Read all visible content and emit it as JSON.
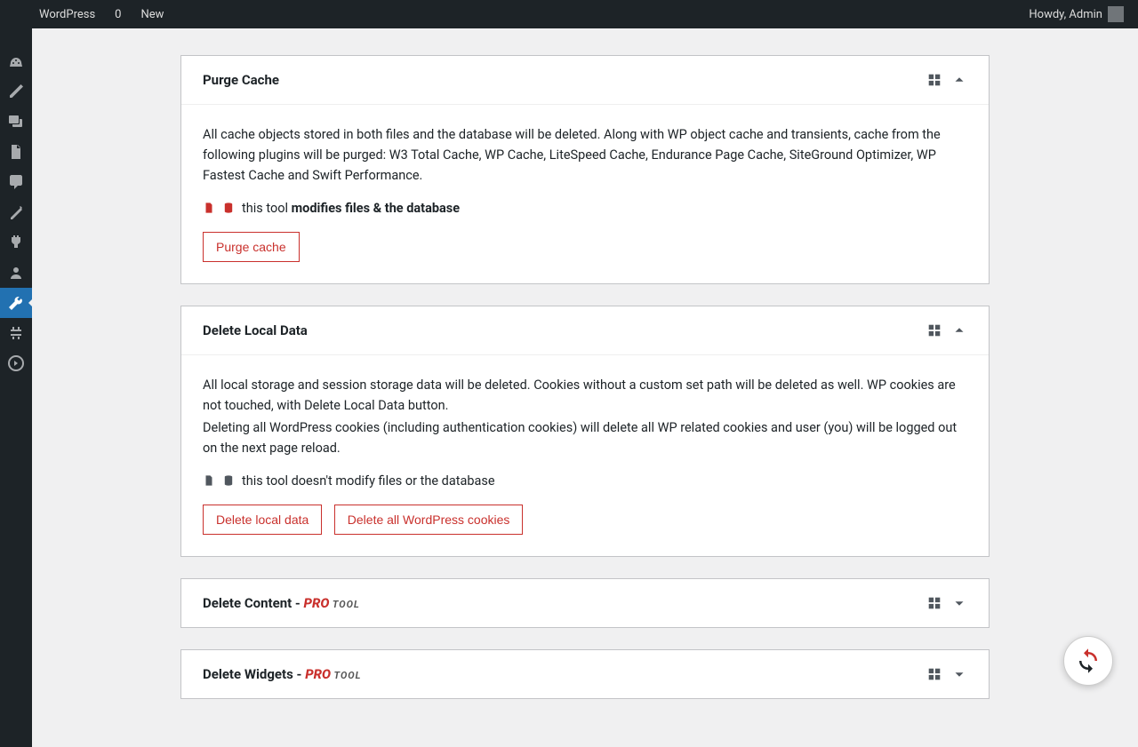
{
  "adminbar": {
    "site_name": "WordPress",
    "comments_count": "0",
    "new_label": "New",
    "howdy": "Howdy, Admin"
  },
  "cards": {
    "purge": {
      "title": "Purge Cache",
      "desc": "All cache objects stored in both files and the database will be deleted. Along with WP object cache and transients, cache from the following plugins will be purged: W3 Total Cache, WP Cache, LiteSpeed Cache, Endurance Page Cache, SiteGround Optimizer, WP Fastest Cache and Swift Performance.",
      "mods_prefix": "this tool ",
      "mods_bold": "modifies files & the database",
      "btn": "Purge cache"
    },
    "local": {
      "title": "Delete Local Data",
      "desc1": "All local storage and session storage data will be deleted. Cookies without a custom set path will be deleted as well. WP cookies are not touched, with Delete Local Data button.",
      "desc2": "Deleting all WordPress cookies (including authentication cookies) will delete all WP related cookies and user (you) will be logged out on the next page reload.",
      "mods": "this tool doesn't modify files or the database",
      "btn1": "Delete local data",
      "btn2": "Delete all WordPress cookies"
    },
    "content": {
      "title_prefix": "Delete Content - ",
      "pro": "PRO",
      "tool": " TOOL"
    },
    "widgets": {
      "title_prefix": "Delete Widgets - ",
      "pro": "PRO",
      "tool": " TOOL"
    }
  }
}
